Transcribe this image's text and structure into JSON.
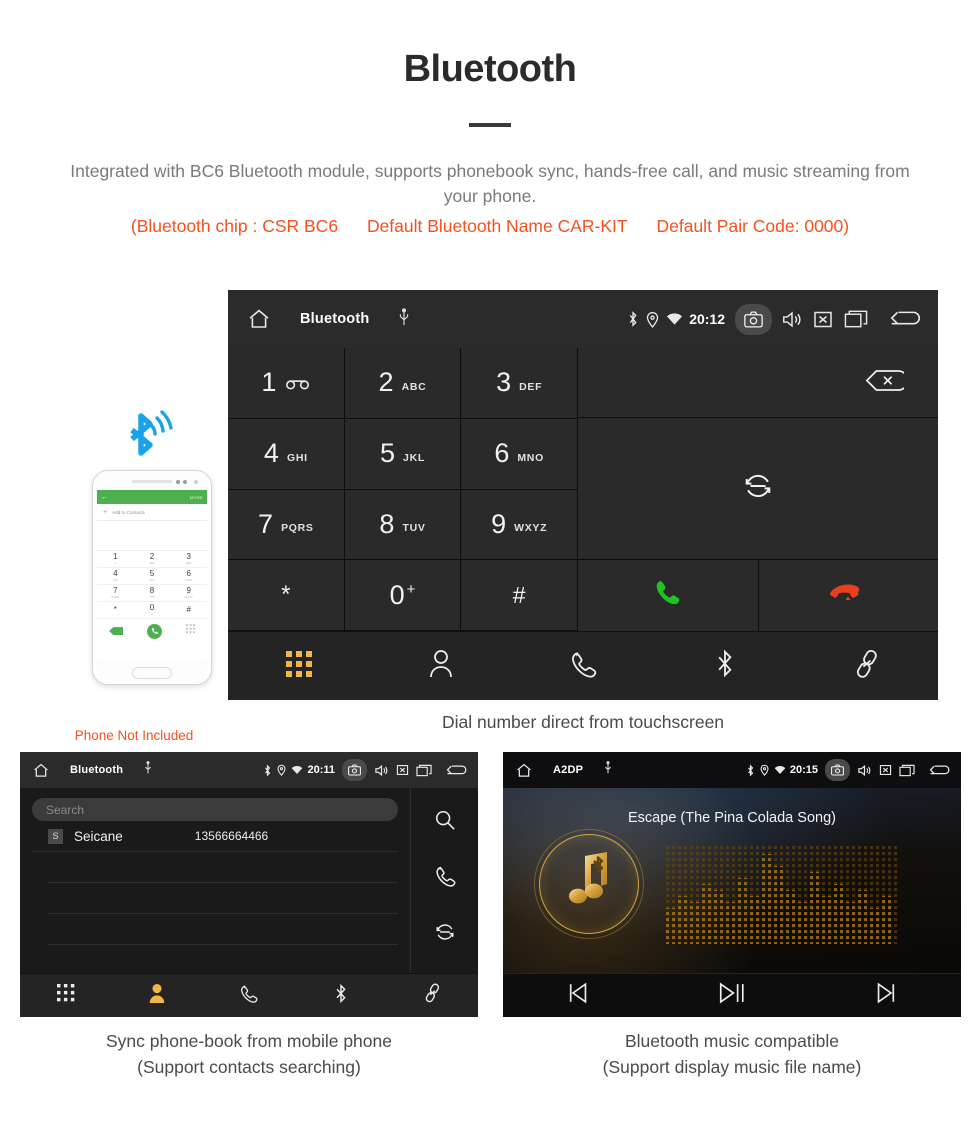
{
  "header": {
    "title": "Bluetooth",
    "subtitle": "Integrated with BC6 Bluetooth module, supports phonebook sync, hands-free call, and music streaming from your phone.",
    "spec_chip": "(Bluetooth chip : CSR BC6",
    "spec_name": "Default Bluetooth Name CAR-KIT",
    "spec_pair": "Default Pair Code: 0000)",
    "accent_color": "#f4511e",
    "text_color": "#7a7a7a"
  },
  "main_unit": {
    "statusbar": {
      "home_icon": "home-icon",
      "title": "Bluetooth",
      "usb_icon": "usb-icon",
      "bluetooth_icon": "bluetooth-icon",
      "location_icon": "location-icon",
      "wifi_icon": "wifi-icon",
      "time": "20:12",
      "camera_icon": "camera-icon",
      "volume_icon": "volume-icon",
      "mute_icon": "mute-x-icon",
      "recents_icon": "recents-icon",
      "back_icon": "back-arrow-icon"
    },
    "keys": [
      {
        "num": "1",
        "sub": "",
        "icon": "voicemail-icon"
      },
      {
        "num": "2",
        "sub": "ABC",
        "icon": ""
      },
      {
        "num": "3",
        "sub": "DEF",
        "icon": ""
      },
      {
        "num": "4",
        "sub": "GHI",
        "icon": ""
      },
      {
        "num": "5",
        "sub": "JKL",
        "icon": ""
      },
      {
        "num": "6",
        "sub": "MNO",
        "icon": ""
      },
      {
        "num": "7",
        "sub": "PQRS",
        "icon": ""
      },
      {
        "num": "8",
        "sub": "TUV",
        "icon": ""
      },
      {
        "num": "9",
        "sub": "WXYZ",
        "icon": ""
      },
      {
        "num": "*",
        "sub": "",
        "icon": ""
      },
      {
        "num": "0",
        "sub": "",
        "icon": "plus-superscript"
      },
      {
        "num": "#",
        "sub": "",
        "icon": ""
      }
    ],
    "right_pane": {
      "delete_icon": "backspace-icon",
      "transfer_icon": "call-transfer-icon",
      "call_icon": "call-answer-icon",
      "hangup_icon": "call-end-icon",
      "call_color": "#1fc41f",
      "hangup_color": "#e8401f"
    },
    "tabs": [
      {
        "name": "keypad",
        "icon": "keypad-grid-icon",
        "active": true
      },
      {
        "name": "contacts",
        "icon": "person-icon",
        "active": false
      },
      {
        "name": "call-history",
        "icon": "phone-handset-icon",
        "active": false
      },
      {
        "name": "bluetooth",
        "icon": "bluetooth-icon",
        "active": false
      },
      {
        "name": "pairing",
        "icon": "link-chain-icon",
        "active": false
      }
    ],
    "active_tab_color": "#f0b64a"
  },
  "phone_mockup": {
    "appbar_back_icon": "back-arrow-icon",
    "appbar_more": "MORE",
    "add_contact_label": "Add to Contacts",
    "keys": [
      {
        "num": "1",
        "sub": "∞"
      },
      {
        "num": "2",
        "sub": "ABC"
      },
      {
        "num": "3",
        "sub": "DEF"
      },
      {
        "num": "4",
        "sub": "GHI"
      },
      {
        "num": "5",
        "sub": "JKL"
      },
      {
        "num": "6",
        "sub": "MNO"
      },
      {
        "num": "7",
        "sub": "PQRS"
      },
      {
        "num": "8",
        "sub": "TUV"
      },
      {
        "num": "9",
        "sub": "WXYZ"
      },
      {
        "num": "*",
        "sub": ""
      },
      {
        "num": "0",
        "sub": "+"
      },
      {
        "num": "#",
        "sub": ""
      }
    ],
    "bluetooth_signal_icon": "bluetooth-signal-icon",
    "call_icon": "call-answer-icon",
    "note": "Phone Not Included",
    "note_color": "#f4511e",
    "appbar_color": "#4caf50"
  },
  "captions": {
    "main": "Dial number direct from touchscreen",
    "bottom_left_line1": "Sync phone-book from mobile phone",
    "bottom_left_line2": "(Support contacts searching)",
    "bottom_right_line1": "Bluetooth music compatible",
    "bottom_right_line2": "(Support display music file name)"
  },
  "contacts_unit": {
    "statusbar": {
      "home_icon": "home-icon",
      "title": "Bluetooth",
      "usb_icon": "usb-icon",
      "time": "20:11",
      "camera_icon": "camera-icon",
      "volume_icon": "volume-icon",
      "mute_icon": "mute-x-icon",
      "recents_icon": "recents-icon",
      "back_icon": "back-arrow-icon"
    },
    "search_placeholder": "Search",
    "contacts": [
      {
        "initial": "S",
        "name": "Seicane",
        "number": "13566664466"
      }
    ],
    "side_actions": [
      {
        "name": "search",
        "icon": "search-icon"
      },
      {
        "name": "call",
        "icon": "phone-handset-icon"
      },
      {
        "name": "sync",
        "icon": "sync-icon"
      }
    ],
    "tabs": [
      {
        "name": "keypad",
        "icon": "keypad-grid-icon",
        "active": false
      },
      {
        "name": "contacts",
        "icon": "person-icon",
        "active": true
      },
      {
        "name": "call-history",
        "icon": "phone-handset-icon",
        "active": false
      },
      {
        "name": "bluetooth",
        "icon": "bluetooth-icon",
        "active": false
      },
      {
        "name": "pairing",
        "icon": "link-chain-icon",
        "active": false
      }
    ]
  },
  "music_unit": {
    "statusbar": {
      "home_icon": "home-icon",
      "title": "A2DP",
      "usb_icon": "usb-icon",
      "time": "20:15",
      "camera_icon": "camera-icon",
      "volume_icon": "volume-icon",
      "mute_icon": "mute-x-icon",
      "recents_icon": "recents-icon",
      "back_icon": "back-arrow-icon"
    },
    "song_title": "Escape (The Pina Colada Song)",
    "album_art_icon": "music-note-bluetooth-icon",
    "visualizer": "dot-matrix-equalizer",
    "accent_color": "#d8a33c",
    "controls": [
      {
        "name": "previous",
        "icon": "skip-previous-icon"
      },
      {
        "name": "play-pause",
        "icon": "play-pause-icon"
      },
      {
        "name": "next",
        "icon": "skip-next-icon"
      }
    ]
  }
}
